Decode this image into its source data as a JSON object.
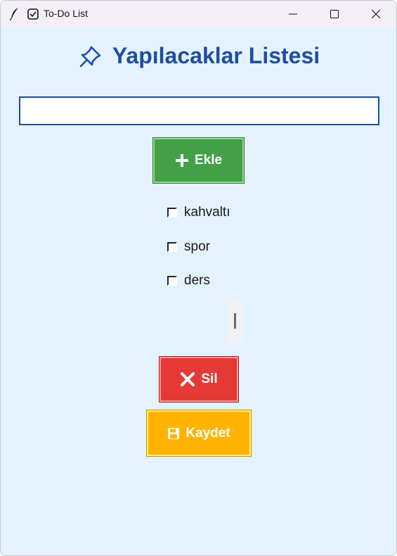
{
  "window": {
    "title": "To-Do List"
  },
  "app": {
    "heading": "Yapılacaklar Listesi"
  },
  "input": {
    "value": "",
    "placeholder": ""
  },
  "buttons": {
    "add_label": "Ekle",
    "delete_label": "Sil",
    "save_label": "Kaydet"
  },
  "tasks": [
    {
      "label": "kahvaltı",
      "checked": false
    },
    {
      "label": "spor",
      "checked": false
    },
    {
      "label": "ders",
      "checked": false
    }
  ],
  "colors": {
    "background": "#e3f2fd",
    "heading": "#1f4ea0",
    "add_button": "#43a047",
    "delete_button": "#e53935",
    "save_button": "#ffb300"
  },
  "icons": [
    "feather-icon",
    "checkbox-icon",
    "minimize-icon",
    "maximize-icon",
    "close-icon",
    "pushpin-icon",
    "plus-icon",
    "x-icon",
    "floppy-disk-icon"
  ]
}
